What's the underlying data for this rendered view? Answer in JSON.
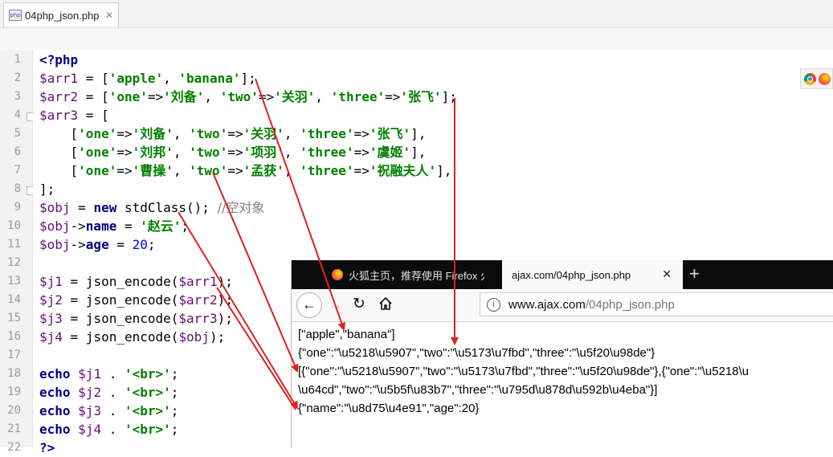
{
  "editor_tab": {
    "filename": "04php_json.php",
    "close": "✕",
    "icon": "php-file-icon",
    "icon_text": "php"
  },
  "line_numbers": [
    "1",
    "2",
    "3",
    "4",
    "5",
    "6",
    "7",
    "8",
    "9",
    "10",
    "11",
    "12",
    "13",
    "14",
    "15",
    "16",
    "17",
    "18",
    "19",
    "20",
    "21",
    "22"
  ],
  "code": {
    "l1": "<?php",
    "l2a": "$arr1",
    "l2b": " = [",
    "l2c": "'apple'",
    "l2d": ", ",
    "l2e": "'banana'",
    "l2f": "];",
    "l3a": "$arr2",
    "l3b": " = [",
    "l3c": "'one'",
    "l3d": "=>",
    "l3e": "'刘备'",
    "l3f": ", ",
    "l3g": "'two'",
    "l3h": "=>",
    "l3i": "'关羽'",
    "l3j": ", ",
    "l3k": "'three'",
    "l3l": "=>",
    "l3m": "'张飞'",
    "l3n": "];",
    "l4a": "$arr3",
    "l4b": " = [",
    "l5a": "    [",
    "l5b": "'one'",
    "l5c": "=>",
    "l5d": "'刘备'",
    "l5e": ", ",
    "l5f": "'two'",
    "l5g": "=>",
    "l5h": "'关羽'",
    "l5i": ", ",
    "l5j": "'three'",
    "l5k": "=>",
    "l5l": "'张飞'",
    "l5m": "],",
    "l6a": "    [",
    "l6b": "'one'",
    "l6c": "=>",
    "l6d": "'刘邦'",
    "l6e": ", ",
    "l6f": "'two'",
    "l6g": "=>",
    "l6h": "'项羽'",
    "l6i": ", ",
    "l6j": "'three'",
    "l6k": "=>",
    "l6l": "'虞姬'",
    "l6m": "],",
    "l7a": "    [",
    "l7b": "'one'",
    "l7c": "=>",
    "l7d": "'曹操'",
    "l7e": ", ",
    "l7f": "'two'",
    "l7g": "=>",
    "l7h": "'孟获'",
    "l7i": ", ",
    "l7j": "'three'",
    "l7k": "=>",
    "l7l": "'祝融夫人'",
    "l7m": "],",
    "l8": "];",
    "l9a": "$obj",
    "l9b": " = ",
    "l9c": "new",
    "l9d": " stdClass(); ",
    "l9e": "//空对象",
    "l10a": "$obj",
    "l10b": "->",
    "l10c": "name",
    "l10d": " = ",
    "l10e": "'赵云'",
    "l10f": ";",
    "l11a": "$obj",
    "l11b": "->",
    "l11c": "age",
    "l11d": " = ",
    "l11e": "20",
    "l11f": ";",
    "l13a": "$j1",
    "l13b": " = json_encode(",
    "l13c": "$arr1",
    "l13d": ");",
    "l14a": "$j2",
    "l14b": " = json_encode(",
    "l14c": "$arr2",
    "l14d": ");",
    "l15a": "$j3",
    "l15b": " = json_encode(",
    "l15c": "$arr3",
    "l15d": ");",
    "l16a": "$j4",
    "l16b": " = json_encode(",
    "l16c": "$obj",
    "l16d": ");",
    "l18a": "echo",
    "l18b": " ",
    "l18c": "$j1",
    "l18d": " . ",
    "l18e": "'<br>'",
    "l18f": ";",
    "l19a": "echo",
    "l19b": " ",
    "l19c": "$j2",
    "l19d": " . ",
    "l19e": "'<br>'",
    "l19f": ";",
    "l20a": "echo",
    "l20b": " ",
    "l20c": "$j3",
    "l20d": " . ",
    "l20e": "'<br>'",
    "l20f": ";",
    "l21a": "echo",
    "l21b": " ",
    "l21c": "$j4",
    "l21d": " . ",
    "l21e": "'<br>'",
    "l21f": ";",
    "l22": "?>"
  },
  "ide_browser_icons": [
    "chrome-icon",
    "firefox-icon"
  ],
  "firefox": {
    "tab1_title": "火狐主页，推荐使用 Firefox 火狐",
    "tab2_title": "ajax.com/04php_json.php",
    "tab2_close": "✕",
    "new_tab": "+",
    "back": "←",
    "forward": "→",
    "reload": "↻",
    "url_domain": "www.ajax.com",
    "url_path": "/04php_json.php",
    "info": "i"
  },
  "output": {
    "line1": "[\"apple\",\"banana\"]",
    "line2": "{\"one\":\"\\u5218\\u5907\",\"two\":\"\\u5173\\u7fbd\",\"three\":\"\\u5f20\\u98de\"}",
    "line3": "[{\"one\":\"\\u5218\\u5907\",\"two\":\"\\u5173\\u7fbd\",\"three\":\"\\u5f20\\u98de\"},{\"one\":\"\\u5218\\u",
    "line4": "\\u64cd\",\"two\":\"\\u5b5f\\u83b7\",\"three\":\"\\u795d\\u878d\\u592b\\u4eba\"}]",
    "line5": "{\"name\":\"\\u8d75\\u4e91\",\"age\":20}"
  },
  "colors": {
    "annotation_arrow": "#e02020",
    "keyword": "#000080",
    "variable": "#660e7a",
    "string": "#008000",
    "number": "#0000ff"
  }
}
